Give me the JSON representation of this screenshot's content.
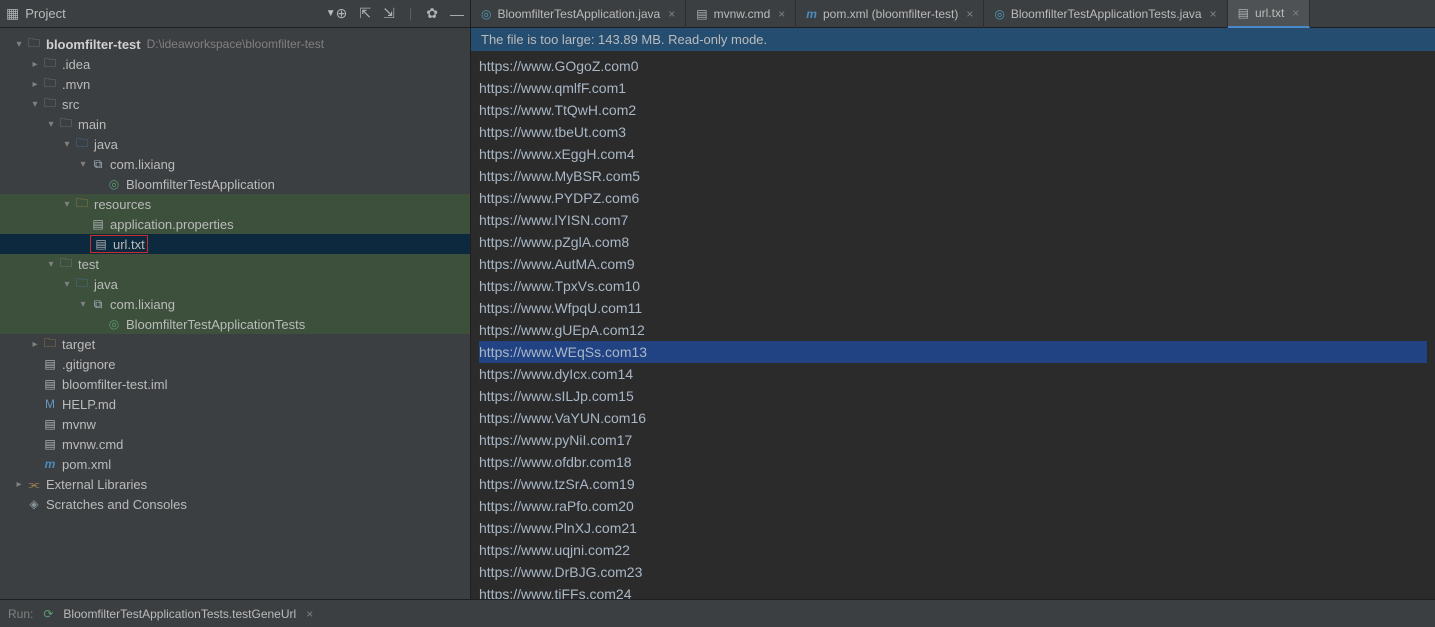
{
  "project_header": {
    "title": "Project"
  },
  "hint_path": "D:\\ideaworkspace\\bloomfilter-test",
  "tabs": [
    {
      "label": "BloomfilterTestApplication.java",
      "icon": "java"
    },
    {
      "label": "mvnw.cmd",
      "icon": "cmd"
    },
    {
      "label": "pom.xml (bloomfilter-test)",
      "icon": "m"
    },
    {
      "label": "BloomfilterTestApplicationTests.java",
      "icon": "java"
    },
    {
      "label": "url.txt",
      "icon": "txt",
      "active": true
    }
  ],
  "notice": "The file is too large: 143.89 MB. Read-only mode.",
  "tree": [
    {
      "indent": 0,
      "arrow": "down",
      "icon": "folder",
      "label": "bloomfilter-test",
      "bold": true,
      "hint": "D:\\ideaworkspace\\bloomfilter-test"
    },
    {
      "indent": 1,
      "arrow": "right",
      "icon": "folder",
      "label": ".idea"
    },
    {
      "indent": 1,
      "arrow": "right",
      "icon": "folder",
      "label": ".mvn"
    },
    {
      "indent": 1,
      "arrow": "down",
      "icon": "folder",
      "label": "src"
    },
    {
      "indent": 2,
      "arrow": "down",
      "icon": "folder",
      "label": "main"
    },
    {
      "indent": 3,
      "arrow": "down",
      "icon": "folder-src",
      "label": "java"
    },
    {
      "indent": 4,
      "arrow": "down",
      "icon": "package",
      "label": "com.lixiang"
    },
    {
      "indent": 5,
      "arrow": "none",
      "icon": "class",
      "label": "BloomfilterTestApplication"
    },
    {
      "indent": 3,
      "arrow": "down",
      "icon": "folder-res",
      "label": "resources",
      "row_class": "resources-row"
    },
    {
      "indent": 4,
      "arrow": "none",
      "icon": "file",
      "label": "application.properties",
      "row_class": "resources-row"
    },
    {
      "indent": 4,
      "arrow": "none",
      "icon": "file",
      "label": "url.txt",
      "selected": true
    },
    {
      "indent": 2,
      "arrow": "down",
      "icon": "folder",
      "label": "test",
      "row_class": "test-row"
    },
    {
      "indent": 3,
      "arrow": "down",
      "icon": "folder-src",
      "label": "java",
      "row_class": "test-row"
    },
    {
      "indent": 4,
      "arrow": "down",
      "icon": "package",
      "label": "com.lixiang",
      "row_class": "test-row"
    },
    {
      "indent": 5,
      "arrow": "none",
      "icon": "class",
      "label": "BloomfilterTestApplicationTests",
      "row_class": "test-row"
    },
    {
      "indent": 1,
      "arrow": "right",
      "icon": "folder-o",
      "label": "target"
    },
    {
      "indent": 1,
      "arrow": "none",
      "icon": "file",
      "label": ".gitignore"
    },
    {
      "indent": 1,
      "arrow": "none",
      "icon": "file",
      "label": "bloomfilter-test.iml"
    },
    {
      "indent": 1,
      "arrow": "none",
      "icon": "md",
      "label": "HELP.md"
    },
    {
      "indent": 1,
      "arrow": "none",
      "icon": "file",
      "label": "mvnw"
    },
    {
      "indent": 1,
      "arrow": "none",
      "icon": "file",
      "label": "mvnw.cmd"
    },
    {
      "indent": 1,
      "arrow": "none",
      "icon": "m",
      "label": "pom.xml"
    },
    {
      "indent": 0,
      "arrow": "right",
      "icon": "lib",
      "label": "External Libraries"
    },
    {
      "indent": 0,
      "arrow": "none",
      "icon": "scratch",
      "label": "Scratches and Consoles"
    }
  ],
  "url_lines": [
    "https://www.GOgoZ.com0",
    "https://www.qmlfF.com1",
    "https://www.TtQwH.com2",
    "https://www.tbeUt.com3",
    "https://www.xEggH.com4",
    "https://www.MyBSR.com5",
    "https://www.PYDPZ.com6",
    "https://www.lYISN.com7",
    "https://www.pZglA.com8",
    "https://www.AutMA.com9",
    "https://www.TpxVs.com10",
    "https://www.WfpqU.com11",
    "https://www.gUEpA.com12",
    "https://www.WEqSs.com13",
    "https://www.dyIcx.com14",
    "https://www.sILJp.com15",
    "https://www.VaYUN.com16",
    "https://www.pyNiI.com17",
    "https://www.ofdbr.com18",
    "https://www.tzSrA.com19",
    "https://www.raPfo.com20",
    "https://www.PlnXJ.com21",
    "https://www.uqjni.com22",
    "https://www.DrBJG.com23",
    "https://www.tiFFs.com24"
  ],
  "selected_line_index": 13,
  "bottom": {
    "run_label": "Run:",
    "config": "BloomfilterTestApplicationTests.testGeneUrl"
  }
}
